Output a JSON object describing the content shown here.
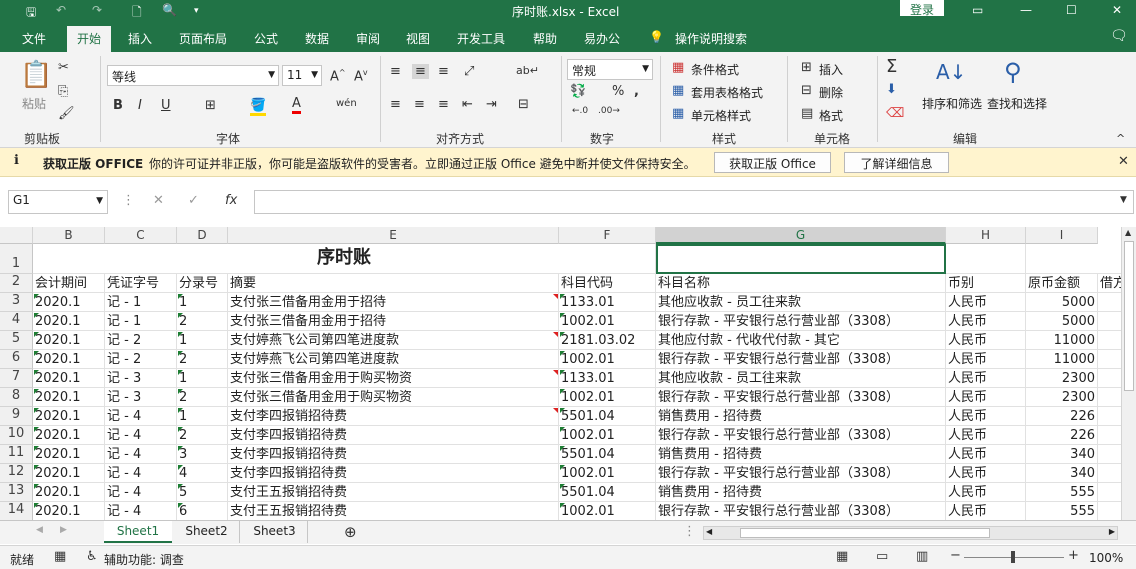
{
  "title_bar": {
    "file_title": "序时账.xlsx  -  Excel",
    "login_label": "登录"
  },
  "ribbon_tabs": [
    "文件",
    "开始",
    "插入",
    "页面布局",
    "公式",
    "数据",
    "审阅",
    "视图",
    "开发工具",
    "帮助",
    "易办公",
    "操作说明搜索"
  ],
  "ribbon": {
    "paste": "粘贴",
    "font_name": "等线",
    "font_size": "11",
    "number_format": "常规",
    "conditional_format": "条件格式",
    "table_format": "套用表格格式",
    "cell_style": "单元格样式",
    "insert": "插入",
    "delete": "删除",
    "format": "格式",
    "sort_filter": "排序和筛选",
    "find_select": "查找和选择",
    "groups": [
      "剪贴板",
      "字体",
      "对齐方式",
      "数字",
      "样式",
      "单元格",
      "编辑"
    ]
  },
  "notification": {
    "title": "获取正版 OFFICE",
    "message": "你的许可证并非正版，你可能是盗版软件的受害者。立即通过正版 Office 避免中断并使文件保持安全。",
    "btn_get": "获取正版 Office",
    "btn_learn": "了解详细信息"
  },
  "formula_bar": {
    "name_box": "G1",
    "fx": "fx",
    "value": ""
  },
  "columns": [
    "B",
    "C",
    "D",
    "E",
    "F",
    "G",
    "H",
    "I"
  ],
  "sheet_title": "序时账",
  "headers": [
    "会计期间",
    "凭证字号",
    "分录号",
    "摘要",
    "科目代码",
    "科目名称",
    "币别",
    "原币金额",
    "借方"
  ],
  "rows": [
    {
      "n": "3",
      "period": "2020.1",
      "voucher": "记 - 1",
      "entry": "1",
      "summary": "支付张三借备用金用于招待",
      "code": "1133.01",
      "name": "其他应收款 - 员工往来款",
      "currency": "人民币",
      "amount": "5000"
    },
    {
      "n": "4",
      "period": "2020.1",
      "voucher": "记 - 1",
      "entry": "2",
      "summary": "支付张三借备用金用于招待",
      "code": "1002.01",
      "name": "银行存款 - 平安银行总行营业部（3308）",
      "currency": "人民币",
      "amount": "5000"
    },
    {
      "n": "5",
      "period": "2020.1",
      "voucher": "记 - 2",
      "entry": "1",
      "summary": "支付婷燕飞公司第四笔进度款",
      "code": "2181.03.02",
      "name": "其他应付款 - 代收代付款 - 其它",
      "currency": "人民币",
      "amount": "11000"
    },
    {
      "n": "6",
      "period": "2020.1",
      "voucher": "记 - 2",
      "entry": "2",
      "summary": "支付婷燕飞公司第四笔进度款",
      "code": "1002.01",
      "name": "银行存款 - 平安银行总行营业部（3308）",
      "currency": "人民币",
      "amount": "11000"
    },
    {
      "n": "7",
      "period": "2020.1",
      "voucher": "记 - 3",
      "entry": "1",
      "summary": "支付张三借备用金用于购买物资",
      "code": "1133.01",
      "name": "其他应收款 - 员工往来款",
      "currency": "人民币",
      "amount": "2300"
    },
    {
      "n": "8",
      "period": "2020.1",
      "voucher": "记 - 3",
      "entry": "2",
      "summary": "支付张三借备用金用于购买物资",
      "code": "1002.01",
      "name": "银行存款 - 平安银行总行营业部（3308）",
      "currency": "人民币",
      "amount": "2300"
    },
    {
      "n": "9",
      "period": "2020.1",
      "voucher": "记 - 4",
      "entry": "1",
      "summary": "支付李四报销招待费",
      "code": "5501.04",
      "name": "销售费用 - 招待费",
      "currency": "人民币",
      "amount": "226"
    },
    {
      "n": "10",
      "period": "2020.1",
      "voucher": "记 - 4",
      "entry": "2",
      "summary": "支付李四报销招待费",
      "code": "1002.01",
      "name": "银行存款 - 平安银行总行营业部（3308）",
      "currency": "人民币",
      "amount": "226"
    },
    {
      "n": "11",
      "period": "2020.1",
      "voucher": "记 - 4",
      "entry": "3",
      "summary": "支付李四报销招待费",
      "code": "5501.04",
      "name": "销售费用 - 招待费",
      "currency": "人民币",
      "amount": "340"
    },
    {
      "n": "12",
      "period": "2020.1",
      "voucher": "记 - 4",
      "entry": "4",
      "summary": "支付李四报销招待费",
      "code": "1002.01",
      "name": "银行存款 - 平安银行总行营业部（3308）",
      "currency": "人民币",
      "amount": "340"
    },
    {
      "n": "13",
      "period": "2020.1",
      "voucher": "记 - 4",
      "entry": "5",
      "summary": "支付王五报销招待费",
      "code": "5501.04",
      "name": "销售费用 - 招待费",
      "currency": "人民币",
      "amount": "555"
    },
    {
      "n": "14",
      "period": "2020.1",
      "voucher": "记 - 4",
      "entry": "6",
      "summary": "支付王五报销招待费",
      "code": "1002.01",
      "name": "银行存款 - 平安银行总行营业部（3308）",
      "currency": "人民币",
      "amount": "555"
    }
  ],
  "sheets": [
    "Sheet1",
    "Sheet2",
    "Sheet3"
  ],
  "status": {
    "ready": "就绪",
    "accessibility": "辅助功能: 调查",
    "zoom": "100%"
  },
  "colors": {
    "accent": "#217346",
    "notify_bg": "#fff4ce"
  }
}
